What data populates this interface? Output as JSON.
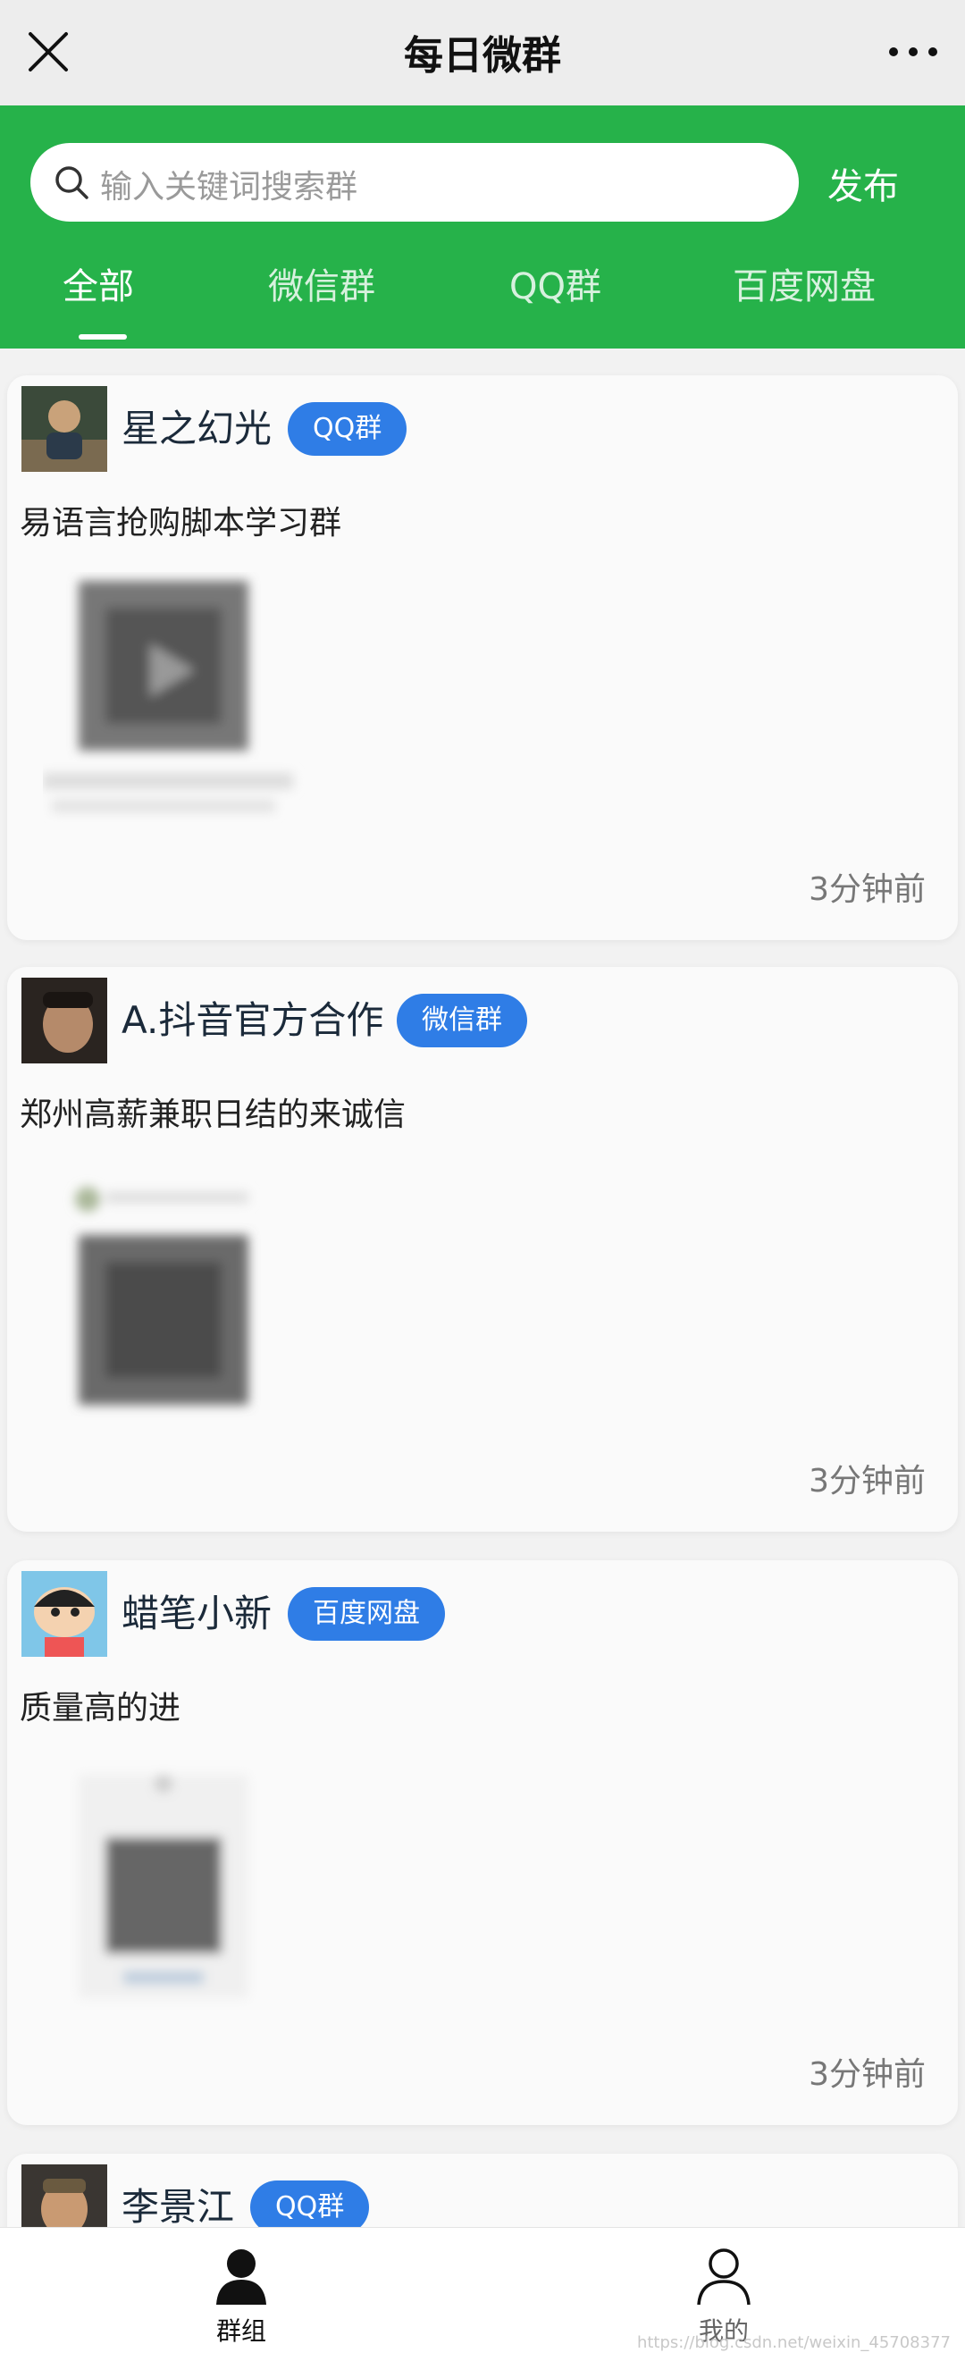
{
  "window": {
    "title": "每日微群",
    "close_icon": "close-icon",
    "more_icon": "more-icon"
  },
  "header": {
    "search_placeholder": "输入关键词搜索群",
    "publish_label": "发布",
    "tabs": [
      "全部",
      "微信群",
      "QQ群",
      "百度网盘"
    ],
    "active_tab": "全部"
  },
  "posts": [
    {
      "name": "星之幻光",
      "badge": "QQ群",
      "description": "易语言抢购脚本学习群",
      "time": "3分钟前"
    },
    {
      "name": "A.抖音官方合作",
      "badge": "微信群",
      "description": "郑州高薪兼职日结的来诚信",
      "time": "3分钟前"
    },
    {
      "name": "蜡笔小新",
      "badge": "百度网盘",
      "description": "质量高的进",
      "time": "3分钟前"
    },
    {
      "name": "李景江",
      "badge": "QQ群"
    }
  ],
  "bottom_nav": {
    "items": [
      {
        "label": "群组",
        "icon": "group-icon",
        "active": true
      },
      {
        "label": "我的",
        "icon": "profile-icon",
        "active": false
      }
    ]
  },
  "watermark": "https://blog.csdn.net/weixin_45708377",
  "colors": {
    "primary_green": "#26b24a",
    "badge_blue": "#2f7de6",
    "title_bar": "#ededed"
  }
}
